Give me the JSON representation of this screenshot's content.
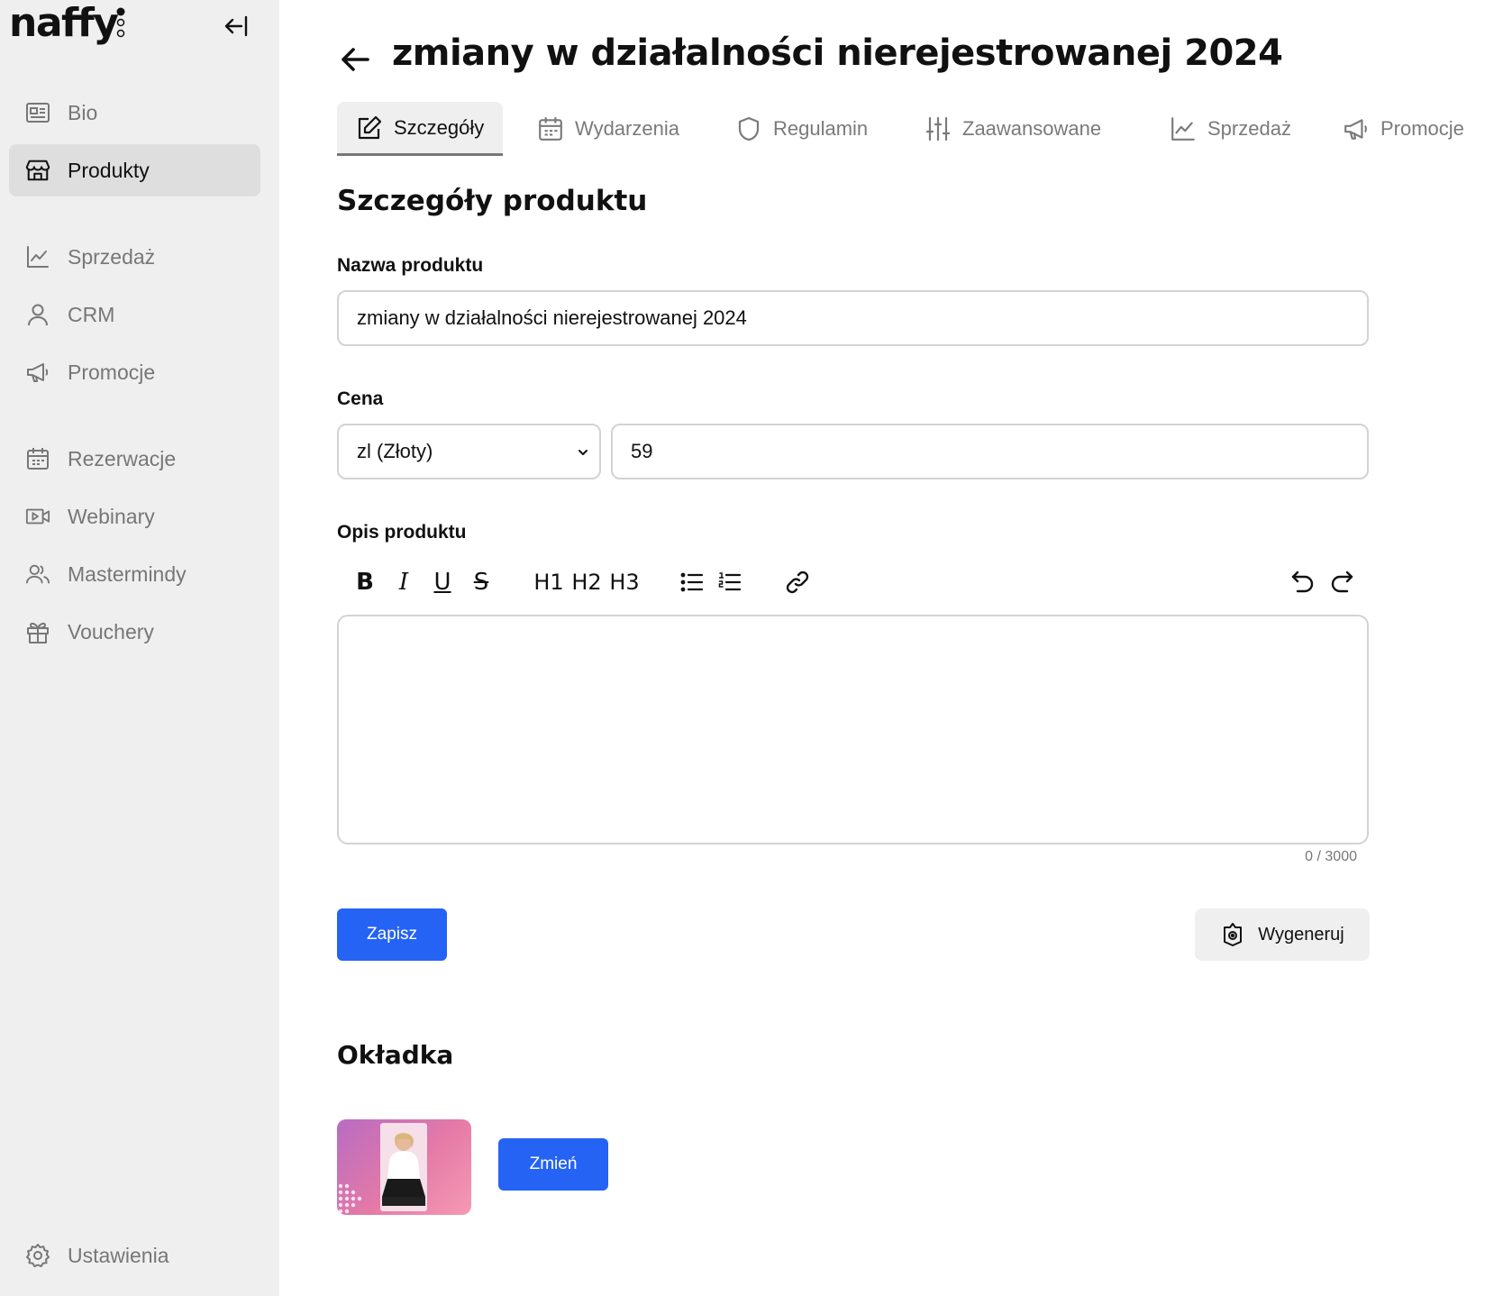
{
  "sidebar": {
    "logo": "naffy",
    "items": [
      {
        "label": "Bio",
        "icon": "id-card-icon"
      },
      {
        "label": "Produkty",
        "icon": "store-icon",
        "active": true
      },
      {
        "label": "Sprzedaż",
        "icon": "chart-line-icon"
      },
      {
        "label": "CRM",
        "icon": "user-icon"
      },
      {
        "label": "Promocje",
        "icon": "megaphone-icon"
      },
      {
        "label": "Rezerwacje",
        "icon": "calendar-icon"
      },
      {
        "label": "Webinary",
        "icon": "video-icon"
      },
      {
        "label": "Mastermindy",
        "icon": "users-icon"
      },
      {
        "label": "Vouchery",
        "icon": "gift-icon"
      }
    ],
    "settings_label": "Ustawienia"
  },
  "header": {
    "title": "zmiany w działalności nierejestrowanej 2024"
  },
  "tabs": [
    {
      "label": "Szczegóły",
      "icon": "edit-icon",
      "active": true
    },
    {
      "label": "Wydarzenia",
      "icon": "calendar-icon"
    },
    {
      "label": "Regulamin",
      "icon": "shield-icon"
    },
    {
      "label": "Zaawansowane",
      "icon": "sliders-icon"
    },
    {
      "label": "Sprzedaż",
      "icon": "chart-line-icon"
    },
    {
      "label": "Promocje",
      "icon": "megaphone-icon"
    }
  ],
  "details": {
    "section_title": "Szczegóły produktu",
    "name_label": "Nazwa produktu",
    "name_value": "zmiany w działalności nierejestrowanej 2024",
    "price_label": "Cena",
    "currency_value": "zl (Złoty)",
    "price_value": "59",
    "description_label": "Opis produktu",
    "toolbar": {
      "bold": "B",
      "italic": "I",
      "underline": "U",
      "strike": "S",
      "h1": "H1",
      "h2": "H2",
      "h3": "H3"
    },
    "description_value": "",
    "counter": "0 / 3000",
    "save_label": "Zapisz",
    "generate_label": "Wygeneruj"
  },
  "cover": {
    "section_title": "Okładka",
    "change_label": "Zmień"
  },
  "colors": {
    "accent": "#2563f5",
    "sidebar_bg": "#efefef",
    "active_item_bg": "#dedede"
  }
}
